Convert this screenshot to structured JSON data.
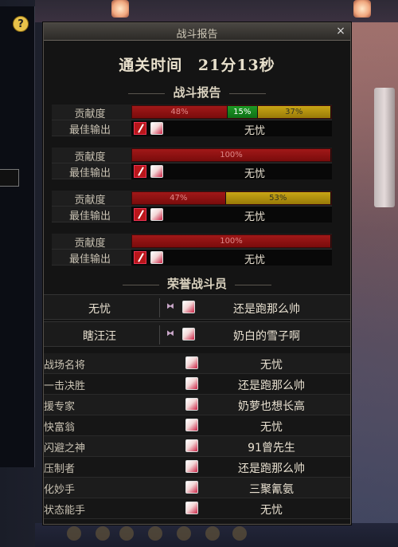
{
  "window": {
    "title": "战斗报告",
    "close_label": "×"
  },
  "help_label": "?",
  "clear_time": {
    "label": "通关时间",
    "value": "21分13秒"
  },
  "sections": {
    "report": "战斗报告",
    "honor": "荣誉战斗员"
  },
  "row_labels": {
    "contribution": "贡献度",
    "best_output": "最佳输出"
  },
  "contribution_blocks": [
    {
      "segments": [
        {
          "label": "48%",
          "value": 48,
          "color": "red"
        },
        {
          "label": "15%",
          "value": 15,
          "color": "green"
        },
        {
          "label": "37%",
          "value": 37,
          "color": "yellow"
        }
      ],
      "best_output": "无忧"
    },
    {
      "segments": [
        {
          "label": "100%",
          "value": 100,
          "color": "red"
        }
      ],
      "best_output": "无忧"
    },
    {
      "segments": [
        {
          "label": "47%",
          "value": 47,
          "color": "red"
        },
        {
          "label": "53%",
          "value": 53,
          "color": "yellow"
        }
      ],
      "best_output": "无忧"
    },
    {
      "segments": [
        {
          "label": "100%",
          "value": 100,
          "color": "red"
        }
      ],
      "best_output": "无忧"
    }
  ],
  "honor_players": [
    {
      "left": "无忧",
      "right": "还是跑那么帅"
    },
    {
      "left": "瞎汪汪",
      "right": "奶白的雪子啊"
    }
  ],
  "awards": [
    {
      "title": "战场名将",
      "player": "无忧"
    },
    {
      "title": "一击决胜",
      "player": "还是跑那么帅"
    },
    {
      "title": "援专家",
      "player": "奶萝也想长高"
    },
    {
      "title": "快富翁",
      "player": "无忧"
    },
    {
      "title": "闪避之神",
      "player": "91曾先生"
    },
    {
      "title": "压制者",
      "player": "还是跑那么帅"
    },
    {
      "title": "化妙手",
      "player": "三聚氰氨"
    },
    {
      "title": "状态能手",
      "player": "无忧"
    }
  ]
}
